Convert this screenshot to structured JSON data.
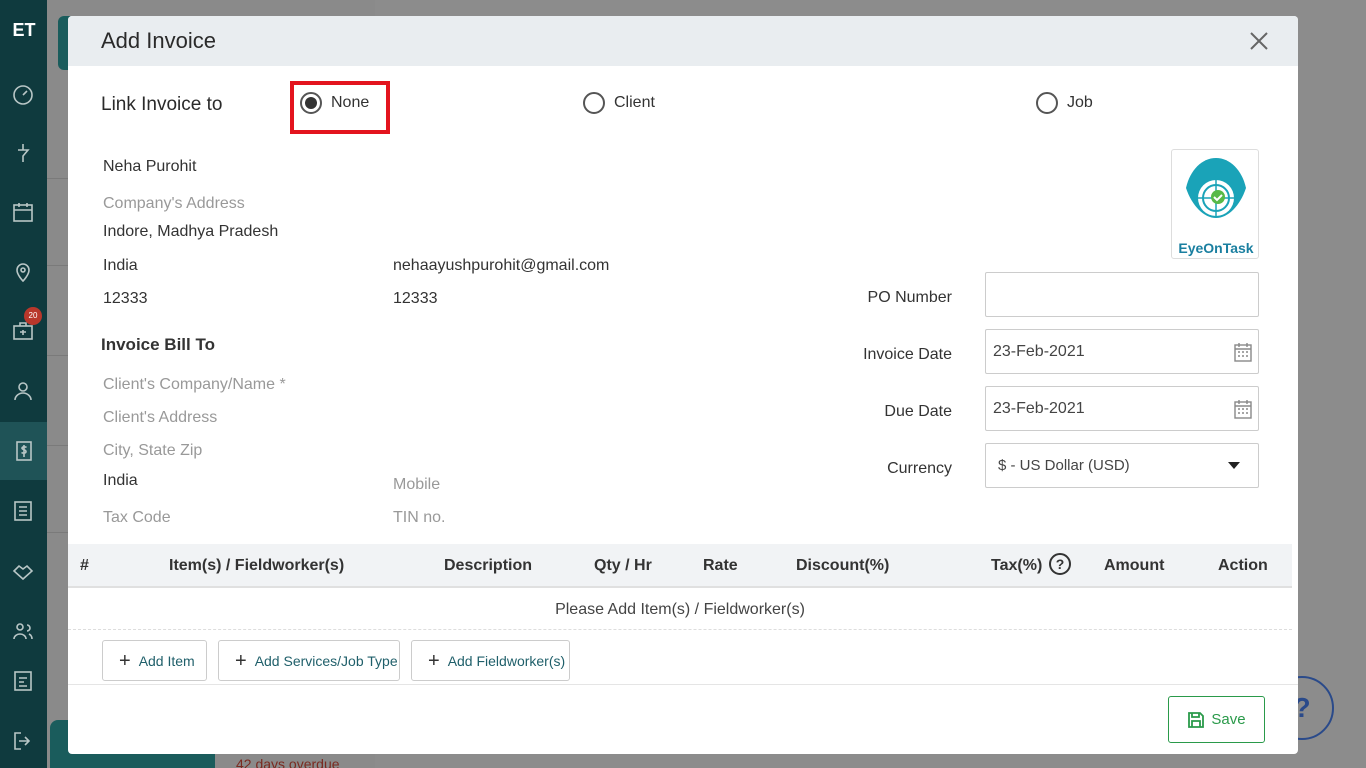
{
  "app": {
    "logo_text": "ET",
    "badge_count": "20"
  },
  "background": {
    "overdue_text": "42 days overdue",
    "help_symbol": "?"
  },
  "modal": {
    "title": "Add Invoice",
    "link_label": "Link Invoice to",
    "radio_options": [
      {
        "label": "None",
        "selected": true
      },
      {
        "label": "Client",
        "selected": false
      },
      {
        "label": "Job",
        "selected": false
      }
    ]
  },
  "company": {
    "name": "Neha Purohit",
    "address_placeholder": "Company's Address",
    "city_state": "Indore, Madhya Pradesh",
    "country": "India",
    "email": "nehaayushpurohit@gmail.com",
    "zip": "12333",
    "phone": "12333",
    "brand_name": "EyeOnTask"
  },
  "bill_to": {
    "heading": "Invoice Bill To",
    "client_name_placeholder": "Client's Company/Name *",
    "client_address_placeholder": "Client's Address",
    "city_state_zip_placeholder": "City, State Zip",
    "country": "India",
    "mobile_placeholder": "Mobile",
    "tax_code_placeholder": "Tax Code",
    "tin_placeholder": "TIN no."
  },
  "invoice_meta": {
    "po_label": "PO Number",
    "po_value": "",
    "invoice_date_label": "Invoice Date",
    "invoice_date": "23-Feb-2021",
    "due_date_label": "Due Date",
    "due_date": "23-Feb-2021",
    "currency_label": "Currency",
    "currency_value": "$ - US Dollar (USD)"
  },
  "table": {
    "headers": [
      "#",
      "Item(s) / Fieldworker(s)",
      "Description",
      "Qty / Hr",
      "Rate",
      "Discount(%)",
      "Tax(%)",
      "Amount",
      "Action"
    ],
    "help_symbol": "?",
    "empty_message": "Please Add Item(s) / Fieldworker(s)"
  },
  "actions": {
    "add_item": "Add Item",
    "add_services": "Add Services/Job Type",
    "add_fieldworker": "Add Fieldworker(s)",
    "save": "Save"
  },
  "colors": {
    "sidebar": "#0f3a3e",
    "highlight": "#e3141e",
    "save": "#2a9a4a",
    "accent": "#1a7fa0"
  }
}
